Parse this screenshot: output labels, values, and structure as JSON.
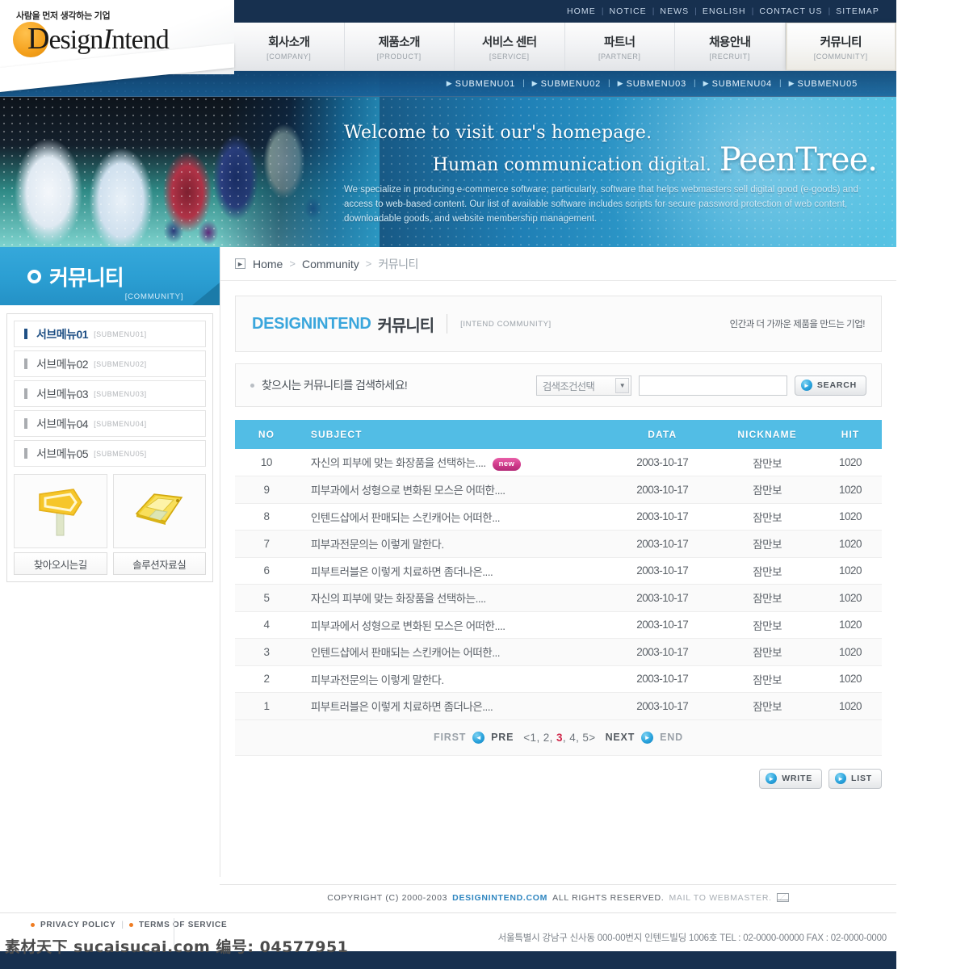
{
  "topbar": {
    "links": [
      "HOME",
      "NOTICE",
      "NEWS",
      "ENGLISH",
      "CONTACT US",
      "SITEMAP"
    ],
    "separator": "|"
  },
  "logo": {
    "tagline": "사람을 먼저 생각하는 기업",
    "brand_d": "D",
    "brand_rest": "esign",
    "brand_i": "I",
    "brand_tail": "ntend",
    "url": "DESIGNINTEND.COM"
  },
  "mainnav": {
    "items": [
      {
        "ko": "회사소개",
        "en": "[COMPANY]",
        "active": false
      },
      {
        "ko": "제품소개",
        "en": "[PRODUCT]",
        "active": false
      },
      {
        "ko": "서비스 센터",
        "en": "[SERVICE]",
        "active": false
      },
      {
        "ko": "파트너",
        "en": "[PARTNER]",
        "active": false
      },
      {
        "ko": "채용안내",
        "en": "[RECRUIT]",
        "active": false
      },
      {
        "ko": "커뮤니티",
        "en": "[COMMUNITY]",
        "active": true
      }
    ]
  },
  "submenu": {
    "items": [
      "SUBMENU01",
      "SUBMENU02",
      "SUBMENU03",
      "SUBMENU04",
      "SUBMENU05"
    ],
    "separator": "|",
    "bullet": "▶"
  },
  "hero": {
    "line1": "Welcome to visit our's homepage.",
    "line2": "Human communication digital.",
    "brand": "PeenTree.",
    "description": "We specialize in producing e-commerce software; particularly, software that helps webmasters sell digital good (e-goods) and access to web-based content. Our list of available software includes scripts for secure password protection of web content, downloadable goods, and website membership management."
  },
  "sidebar": {
    "title_ko": "커뮤니티",
    "title_en": "[COMMUNITY]",
    "items": [
      {
        "ko": "서브메뉴01",
        "en": "[SUBMENU01]",
        "active": true
      },
      {
        "ko": "서브메뉴02",
        "en": "[SUBMENU02]",
        "active": false
      },
      {
        "ko": "서브메뉴03",
        "en": "[SUBMENU03]",
        "active": false
      },
      {
        "ko": "서브메뉴04",
        "en": "[SUBMENU04]",
        "active": false
      },
      {
        "ko": "서브메뉴05",
        "en": "[SUBMENU05]",
        "active": false
      }
    ],
    "banners": [
      {
        "label": "찾아오시는길",
        "icon": "signpost-arrow-icon"
      },
      {
        "label": "솔루션자료실",
        "icon": "floppy-disk-icon"
      }
    ]
  },
  "breadcrumb": {
    "home": "Home",
    "section": "Community",
    "current": "커뮤니티",
    "separator": ">"
  },
  "page_title": {
    "en": "DESIGNINTEND",
    "ko": "커뮤니티",
    "sub": "[INTEND COMMUNITY]",
    "slogan": "인간과 더 가까운 제품을 만드는 기업!"
  },
  "search": {
    "prompt": "찾으시는 커뮤니티를 검색하세요!",
    "select_value": "검색조건선택",
    "input_value": "",
    "input_placeholder": "",
    "button_label": "SEARCH"
  },
  "table": {
    "headers": [
      "NO",
      "SUBJECT",
      "DATA",
      "NICKNAME",
      "HIT"
    ],
    "rows": [
      {
        "no": "10",
        "subject": "자신의 피부에 맞는 화장품을 선택하는....",
        "badge": "new",
        "date": "2003-10-17",
        "nickname": "잠만보",
        "hit": "1020"
      },
      {
        "no": "9",
        "subject": "피부과에서 성형으로 변화된 모스은 어떠한....",
        "badge": "",
        "date": "2003-10-17",
        "nickname": "잠만보",
        "hit": "1020"
      },
      {
        "no": "8",
        "subject": "인텐드샵에서 판매되는 스킨캐어는 어떠한...",
        "badge": "",
        "date": "2003-10-17",
        "nickname": "잠만보",
        "hit": "1020"
      },
      {
        "no": "7",
        "subject": "피부과전문의는 이렇게 말한다.",
        "badge": "",
        "date": "2003-10-17",
        "nickname": "잠만보",
        "hit": "1020"
      },
      {
        "no": "6",
        "subject": "피부트러블은 이렇게 치료하면 좀더나은....",
        "badge": "",
        "date": "2003-10-17",
        "nickname": "잠만보",
        "hit": "1020"
      },
      {
        "no": "5",
        "subject": "자신의 피부에 맞는 화장품을 선택하는....",
        "badge": "",
        "date": "2003-10-17",
        "nickname": "잠만보",
        "hit": "1020"
      },
      {
        "no": "4",
        "subject": "피부과에서 성형으로 변화된 모스은 어떠한....",
        "badge": "",
        "date": "2003-10-17",
        "nickname": "잠만보",
        "hit": "1020"
      },
      {
        "no": "3",
        "subject": "인텐드샵에서 판매되는 스킨캐어는 어떠한...",
        "badge": "",
        "date": "2003-10-17",
        "nickname": "잠만보",
        "hit": "1020"
      },
      {
        "no": "2",
        "subject": "피부과전문의는 이렇게 말한다.",
        "badge": "",
        "date": "2003-10-17",
        "nickname": "잠만보",
        "hit": "1020"
      },
      {
        "no": "1",
        "subject": "피부트러블은 이렇게 치료하면 좀더나은....",
        "badge": "",
        "date": "2003-10-17",
        "nickname": "잠만보",
        "hit": "1020"
      }
    ]
  },
  "pagination": {
    "first": "FIRST",
    "pre": "PRE",
    "pages_prefix": "<1, 2, ",
    "current_page": "3",
    "pages_suffix": ", 4, 5>",
    "next": "NEXT",
    "end": "END"
  },
  "actions": {
    "write": "WRITE",
    "list": "LIST"
  },
  "footer": {
    "copyright_prefix": "COPYRIGHT (C) 2000-2003",
    "copyright_link": "DESIGNINTEND.COM",
    "copyright_mid": "ALL RIGHTS RESERVED.",
    "mail_text": "MAIL TO WEBMASTER.",
    "privacy": "PRIVACY POLICY",
    "terms": "TERMS OF SERVICE",
    "separator": "|",
    "address": "서울특별시  강남구 신사동 000-00번지 인텐드빌딩 1006호  TEL : 02-0000-00000  FAX : 02-0000-0000"
  },
  "watermark": {
    "text": "素材天下 sucaisucai.com  编号: 04577951"
  },
  "colors": {
    "navy": "#17304f",
    "accent_blue": "#35a8db",
    "table_header": "#52bde5",
    "badge_pink": "#d03a8b",
    "current_page": "#cf2649",
    "logo_orange": "#f4a01b"
  }
}
